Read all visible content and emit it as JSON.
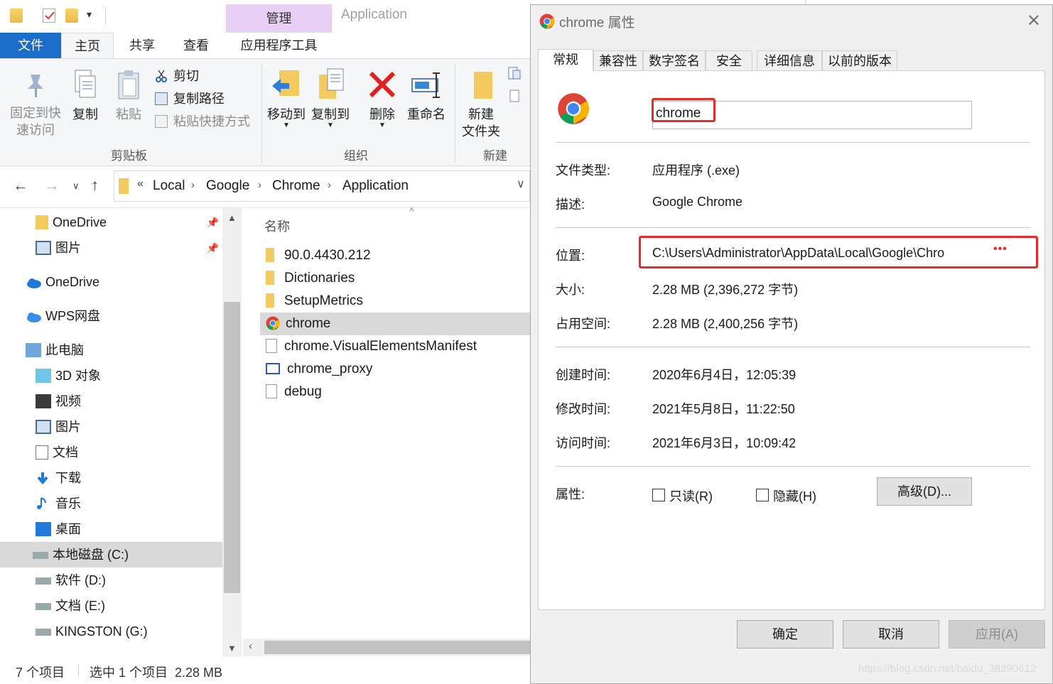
{
  "explorer": {
    "title": "Application",
    "context_tab": "管理",
    "ribbon_tabs": [
      "文件",
      "主页",
      "共享",
      "查看",
      "应用程序工具"
    ],
    "ribbon": {
      "pin_label": "固定到快\n速访问",
      "copy_label": "复制",
      "paste_label": "粘贴",
      "cut_label": "剪切",
      "copy_path_label": "复制路径",
      "paste_shortcut_label": "粘贴快捷方式",
      "clipboard_group": "剪贴板",
      "move_to_label": "移动到",
      "copy_to_label": "复制到",
      "delete_label": "删除",
      "rename_label": "重命名",
      "organize_group": "组织",
      "new_folder_label": "新建\n文件夹",
      "new_group": "新建"
    },
    "breadcrumb": {
      "overflow": "«",
      "items": [
        "Local",
        "Google",
        "Chrome",
        "Application"
      ]
    },
    "nav_items": [
      {
        "label": "OneDrive",
        "icon": "folder-icon"
      },
      {
        "label": "图片",
        "icon": "pictures-icon"
      },
      {
        "label": "OneDrive",
        "icon": "cloud-icon"
      },
      {
        "label": "WPS网盘",
        "icon": "cloud-icon"
      },
      {
        "label": "此电脑",
        "icon": "computer-icon"
      },
      {
        "label": "3D 对象",
        "icon": "3d-objects-icon"
      },
      {
        "label": "视频",
        "icon": "video-icon"
      },
      {
        "label": "图片",
        "icon": "pictures-icon"
      },
      {
        "label": "文档",
        "icon": "documents-icon"
      },
      {
        "label": "下载",
        "icon": "download-icon"
      },
      {
        "label": "音乐",
        "icon": "music-icon"
      },
      {
        "label": "桌面",
        "icon": "desktop-icon"
      },
      {
        "label": "本地磁盘 (C:)",
        "icon": "drive-icon"
      },
      {
        "label": "软件 (D:)",
        "icon": "drive-icon"
      },
      {
        "label": "文档 (E:)",
        "icon": "drive-icon"
      },
      {
        "label": "KINGSTON (G:)",
        "icon": "drive-icon"
      }
    ],
    "column_header": "名称",
    "files": [
      {
        "name": "90.0.4430.212",
        "icon": "folder-icon"
      },
      {
        "name": "Dictionaries",
        "icon": "folder-icon"
      },
      {
        "name": "SetupMetrics",
        "icon": "folder-icon"
      },
      {
        "name": "chrome",
        "icon": "chrome-icon",
        "selected": true
      },
      {
        "name": "chrome.VisualElementsManifest",
        "icon": "manifest-icon"
      },
      {
        "name": "chrome_proxy",
        "icon": "exe-icon"
      },
      {
        "name": "debug",
        "icon": "text-file-icon"
      }
    ],
    "status": {
      "count": "7 个项目",
      "selection": "选中 1 个项目  2.28 MB"
    }
  },
  "dialog": {
    "title": "chrome 属性",
    "tabs": [
      "常规",
      "兼容性",
      "数字签名",
      "安全",
      "详细信息",
      "以前的版本"
    ],
    "name_value": "chrome",
    "rows": {
      "file_type_label": "文件类型:",
      "file_type_value": "应用程序 (.exe)",
      "desc_label": "描述:",
      "desc_value": "Google Chrome",
      "location_label": "位置:",
      "location_value": "C:\\Users\\Administrator\\AppData\\Local\\Google\\Chro",
      "size_label": "大小:",
      "size_value": "2.28 MB (2,396,272 字节)",
      "disk_label": "占用空间:",
      "disk_value": "2.28 MB (2,400,256 字节)",
      "created_label": "创建时间:",
      "created_value": "2020年6月4日，12:05:39",
      "modified_label": "修改时间:",
      "modified_value": "2021年5月8日，11:22:50",
      "accessed_label": "访问时间:",
      "accessed_value": "2021年6月3日，10:09:42",
      "attrs_label": "属性:",
      "readonly_label": "只读(R)",
      "hidden_label": "隐藏(H)",
      "advanced_label": "高级(D)..."
    },
    "ellipsis": "•••",
    "buttons": {
      "ok": "确定",
      "cancel": "取消",
      "apply": "应用(A)"
    }
  },
  "watermark": "https://blog.csdn.net/baidu_38290612",
  "colors": {
    "file_tab": "#1c6dc9",
    "context_tab": "#e8cff5",
    "highlight_box": "#e52a2a",
    "selection": "#d9d9d9"
  }
}
